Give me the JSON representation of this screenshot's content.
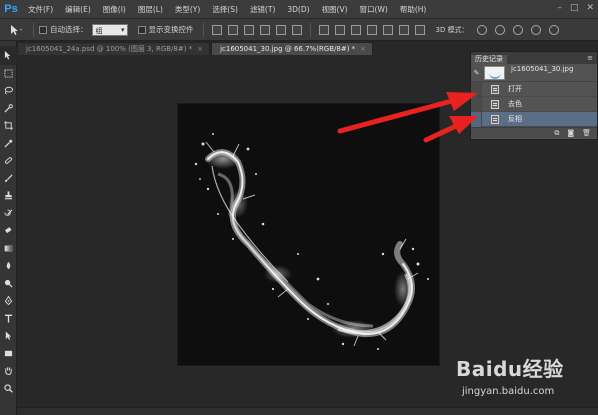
{
  "app": {
    "logo": "Ps",
    "menu": [
      "文件(F)",
      "编辑(E)",
      "图像(I)",
      "图层(L)",
      "类型(Y)",
      "选择(S)",
      "滤镜(T)",
      "3D(D)",
      "视图(V)",
      "窗口(W)",
      "帮助(H)"
    ],
    "window_controls": [
      "–",
      "□",
      "✕"
    ]
  },
  "options": {
    "auto_select_label": "自动选择：",
    "auto_select_value": "组",
    "show_transform_label": "显示变换控件",
    "mode_3d_label": "3D 模式："
  },
  "tabs": [
    {
      "label": "jc1605041_24a.psd @ 100% (图层 3, RGB/8#) *",
      "close": "×",
      "active": false
    },
    {
      "label": "jc1605041_30.jpg @ 66.7%(RGB/8#) *",
      "close": "×",
      "active": true
    }
  ],
  "toolbar": {
    "tools": [
      "move-tool",
      "marquee-tool",
      "lasso-tool",
      "quick-select-tool",
      "crop-tool",
      "eyedropper-tool",
      "healing-brush-tool",
      "brush-tool",
      "clone-stamp-tool",
      "history-brush-tool",
      "eraser-tool",
      "gradient-tool",
      "blur-tool",
      "dodge-tool",
      "pen-tool",
      "type-tool",
      "path-select-tool",
      "shape-tool",
      "hand-tool",
      "zoom-tool"
    ]
  },
  "history_panel": {
    "title": "历史记录",
    "menu_icon": "≡",
    "snapshot_label": "jc1605041_30.jpg",
    "items": [
      {
        "label": "打开",
        "selected": false
      },
      {
        "label": "去色",
        "selected": false
      },
      {
        "label": "反相",
        "selected": true
      }
    ],
    "footer_icons": [
      "new-document-from-state-icon",
      "snapshot-camera-icon",
      "trash-icon"
    ]
  },
  "watermark": {
    "logo_text": "Baidu经验",
    "url": "jingyan.baidu.com"
  },
  "colors": {
    "arrow": "#e8231f",
    "selected_row": "#5a6e86",
    "ps_blue": "#31a8ff"
  }
}
